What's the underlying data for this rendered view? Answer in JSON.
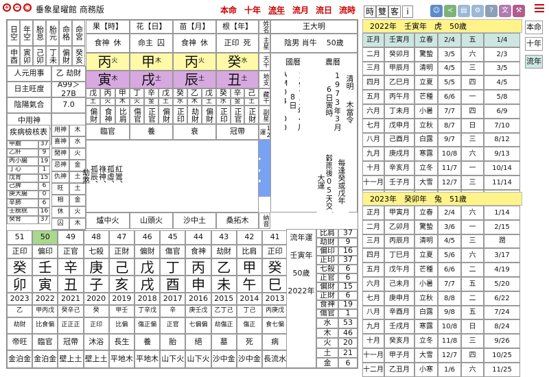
{
  "app": {
    "name": "垂象星曜館 商務版"
  },
  "toolbar": {
    "nav": [
      "本命",
      "十年",
      "流年",
      "流月",
      "流日",
      "流時"
    ],
    "active_nav": "流年",
    "modes": [
      "時",
      "雙",
      "客",
      "i"
    ]
  },
  "side_tabs": [
    "本命",
    "十年",
    "流年"
  ],
  "overlay": {
    "label": "流年盤"
  },
  "left_labels": {
    "r1": [
      "日空",
      "年空",
      "胎息",
      "胎元",
      "命格",
      "命宮"
    ],
    "r2": [
      "申酉",
      "寅卯",
      "己卯",
      "丁未",
      "偏財",
      "癸亥"
    ],
    "yuanyong": "人元用事",
    "yuanyong_val": "乙 劫財",
    "rizhu": "日主旺度",
    "rizhu_val": "A99＞27B",
    "yinyang": "陰陽氣合",
    "yinyang_val": "7.0",
    "zhongyong": "中用神",
    "geju": "格局用神",
    "jibing": "疾病檢核表"
  },
  "organs": [
    [
      "甲膽",
      "37"
    ],
    [
      "乙肝",
      "9"
    ],
    [
      "丙小腸",
      "19"
    ],
    [
      "丁心",
      "1"
    ],
    [
      "戊胃",
      "15"
    ],
    [
      "己脾",
      "6"
    ],
    [
      "庚大腸",
      "0"
    ],
    [
      "辛肺",
      "6"
    ],
    [
      "壬膀胱",
      "16"
    ],
    [
      "癸腎",
      "37"
    ]
  ],
  "shen_table": [
    [
      "用神",
      "木"
    ],
    [
      "喜神",
      "水"
    ],
    [
      "閒神",
      "火"
    ],
    [
      "忌神",
      "金"
    ],
    [
      "仇神",
      "土"
    ]
  ],
  "wang_table": [
    [
      "旺",
      "土"
    ],
    [
      "相",
      "金"
    ],
    [
      "休",
      "火"
    ],
    [
      "囚",
      "木"
    ],
    [
      "死",
      "水"
    ]
  ],
  "pillars": [
    {
      "head": "果【時】",
      "tg": "食神",
      "st": "休",
      "stem": "丙",
      "se": "火",
      "branch": "寅",
      "be": "木",
      "hidden": [
        "戊",
        "丙",
        "甲"
      ],
      "he": [
        "土",
        "火",
        "木"
      ],
      "gods": [
        "偏財",
        "食神",
        "比肩"
      ],
      "phase": "臨官",
      "nayin": "爐中火"
    },
    {
      "head": "花【日】",
      "tg": "命主",
      "st": "囚",
      "stem": "甲",
      "se": "木",
      "branch": "戌",
      "be": "土",
      "hidden": [
        "丁",
        "辛",
        "戊"
      ],
      "he": [
        "火",
        "金",
        "土"
      ],
      "gods": [
        "傷官",
        "正官",
        "偏財"
      ],
      "phase": "養",
      "nayin": "山頭火"
    },
    {
      "head": "苗【月】",
      "tg": "食神",
      "st": "休",
      "stem": "丙",
      "se": "火",
      "branch": "辰",
      "be": "土",
      "hidden": [
        "癸",
        "乙",
        "戊"
      ],
      "he": [
        "水",
        "木",
        "土"
      ],
      "gods": [
        "正印",
        "劫財",
        "偏財"
      ],
      "phase": "衰",
      "nayin": "沙中土"
    },
    {
      "head": "根【年】",
      "tg": "正印",
      "st": "死",
      "stem": "癸",
      "se": "水",
      "branch": "丑",
      "be": "土",
      "hidden": [
        "癸",
        "辛",
        "己"
      ],
      "he": [
        "水",
        "金",
        "土"
      ],
      "gods": [
        "正印",
        "正官",
        "正財"
      ],
      "phase": "冠帶",
      "nayin": "桑拓木"
    }
  ],
  "shensha": [
    "紅鸞、",
    "孤虛、",
    "祿神、",
    "孤辰、",
    "劫煞"
  ],
  "side_cols": [
    "姓名",
    "主星",
    "天干",
    "地支",
    "藏干",
    "副星",
    "12運"
  ],
  "name": {
    "label": "王大明",
    "gender": "陰男 肖牛",
    "age": "50歲"
  },
  "calendar": {
    "solar_title": "國曆",
    "solar": "1973年4月8日AM04:00",
    "lunar_title": "農曆",
    "lunar": "1973年3月6日寅時",
    "qing": "清明",
    "dang": "木當令",
    "yun": "穀雨後05天交大運",
    "yun2": "每逢癸或戊年"
  },
  "nayin_col": "納音",
  "dayun": {
    "ages": [
      "51",
      "50",
      "49",
      "48",
      "47",
      "46",
      "45",
      "44",
      "43",
      "42",
      "41",
      "40"
    ],
    "active_age": "50",
    "gods": [
      "正印",
      "偏印",
      "正官",
      "七殺",
      "正財",
      "偏財",
      "傷官",
      "食神",
      "劫財",
      "比肩",
      "正印",
      "偏印"
    ],
    "stems": [
      "癸",
      "壬",
      "辛",
      "庚",
      "己",
      "戊",
      "丁",
      "丙",
      "乙",
      "甲",
      "癸",
      "壬"
    ],
    "branches": [
      "卯",
      "寅",
      "丑",
      "子",
      "亥",
      "戌",
      "酉",
      "申",
      "未",
      "午",
      "巳",
      "辰"
    ],
    "years": [
      "2023",
      "2022",
      "2021",
      "2020",
      "2019",
      "2018",
      "2017",
      "2016",
      "2015",
      "2014",
      "2013",
      "2012"
    ],
    "hidden": [
      "乙",
      "甲丙戊",
      "癸辛己",
      "癸",
      "甲壬",
      "丁辛戊",
      "辛",
      "庚壬戊",
      "乙丁己",
      "丁己",
      "丙庚戊",
      "乙戊癸"
    ],
    "hgods": [
      "劫財",
      "比食偏",
      "正正正",
      "正印",
      "比偏",
      "傷正偏",
      "正官",
      "七偏偏",
      "劫傷正",
      "傷正",
      "食七偏",
      "劫偏正"
    ],
    "phase": [
      "帝旺",
      "臨官",
      "冠帶",
      "沐浴",
      "長生",
      "養",
      "胎",
      "絕",
      "墓",
      "死",
      "病",
      "衰"
    ],
    "nayin": [
      "金泊金",
      "金泊金",
      "壁上土",
      "壁上土",
      "平地木",
      "平地木",
      "山下火",
      "山下火",
      "沙中金",
      "沙中金",
      "長流水",
      "長流水"
    ]
  },
  "liunian": {
    "title": "流年運",
    "gz": "壬寅年",
    "age": "50歲",
    "year": "2022年"
  },
  "tengod_counts": [
    [
      "比肩",
      "37"
    ],
    [
      "劫財",
      "9"
    ],
    [
      "偏印",
      "16"
    ],
    [
      "正印",
      "37"
    ],
    [
      "七殺",
      "6"
    ],
    [
      "正官",
      "6"
    ],
    [
      "偏財",
      "15"
    ],
    [
      "正財",
      "6"
    ],
    [
      "食神",
      "19"
    ],
    [
      "傷官",
      "1"
    ]
  ],
  "element_counts": [
    [
      "水",
      "53"
    ],
    [
      "木",
      "46"
    ],
    [
      "火",
      "20"
    ],
    [
      "土",
      "21"
    ],
    [
      "金",
      "6"
    ]
  ],
  "year_tables": [
    {
      "title": "2022年　壬寅年　虎　50歲",
      "rows": [
        [
          "正月",
          "壬寅月",
          "立春",
          "2/4",
          "五",
          "1/4"
        ],
        [
          "二月",
          "癸卯月",
          "驚蟄",
          "3/5",
          "六",
          "2/3"
        ],
        [
          "三月",
          "甲辰月",
          "清明",
          "4/5",
          "三",
          "3/5"
        ],
        [
          "四月",
          "乙巳月",
          "立夏",
          "5/5",
          "四",
          "4/5"
        ],
        [
          "五月",
          "丙午月",
          "芒種",
          "6/6",
          "一",
          "5/8"
        ],
        [
          "六月",
          "丁未月",
          "小暑",
          "7/7",
          "四",
          "6/9"
        ],
        [
          "七月",
          "戊申月",
          "立秋",
          "8/7",
          "日",
          "7/10"
        ],
        [
          "八月",
          "己酉月",
          "白露",
          "9/7",
          "三",
          "8/12"
        ],
        [
          "九月",
          "庚戌月",
          "寒露",
          "10/8",
          "六",
          "9/13"
        ],
        [
          "十月",
          "辛亥月",
          "立冬",
          "11/7",
          "一",
          "10/14"
        ],
        [
          "十一月",
          "壬子月",
          "大雪",
          "12/7",
          "三",
          "11/14"
        ],
        [
          "十二月",
          "癸丑月",
          "小寒",
          "1/5",
          "四",
          "12/14"
        ]
      ]
    },
    {
      "title": "2023年　癸卯年　兔　51歲",
      "rows": [
        [
          "正月",
          "甲寅月",
          "立春",
          "2/4",
          "六",
          "1/14"
        ],
        [
          "二月",
          "乙卯月",
          "驚蟄",
          "3/6",
          "一",
          "2/15"
        ],
        [
          "三月",
          "丙辰月",
          "清明",
          "4/5",
          "三",
          "潤"
        ],
        [
          "四月",
          "丁巳月",
          "立夏",
          "5/6",
          "六",
          "3/17"
        ],
        [
          "五月",
          "戊午月",
          "芒種",
          "6/6",
          "二",
          "4/19"
        ],
        [
          "六月",
          "己未月",
          "小暑",
          "7/7",
          "五",
          "5/20"
        ],
        [
          "七月",
          "庚申月",
          "立秋",
          "8/8",
          "二",
          "6/22"
        ],
        [
          "八月",
          "辛酉月",
          "白露",
          "9/8",
          "五",
          "7/24"
        ],
        [
          "九月",
          "壬戌月",
          "寒露",
          "10/8",
          "日",
          "8/24"
        ],
        [
          "十月",
          "癸亥月",
          "立冬",
          "11/8",
          "三",
          "9/26"
        ],
        [
          "十一月",
          "甲子月",
          "大雪",
          "12/7",
          "四",
          "10/25"
        ],
        [
          "十二月",
          "乙丑月",
          "小寒",
          "1/6",
          "六",
          "11/25"
        ]
      ]
    }
  ]
}
